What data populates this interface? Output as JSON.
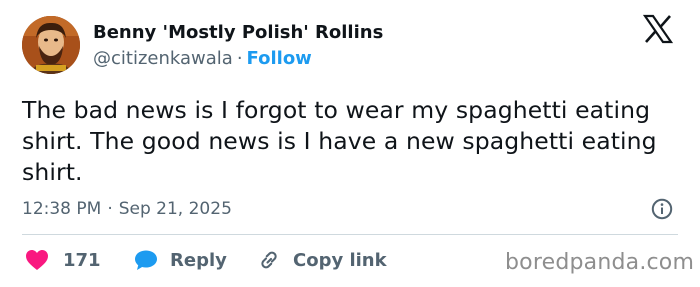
{
  "author": {
    "display_name": "Benny 'Mostly Polish' Rollins",
    "handle": "@citizenkawala",
    "separator": "·",
    "follow_label": "Follow"
  },
  "tweet": {
    "text": "The bad news is I forgot to wear my spaghetti eating shirt. The good news is I have a new spaghetti eating shirt.",
    "time": "12:38 PM",
    "date_separator": "·",
    "date": "Sep 21, 2025"
  },
  "actions": {
    "like_count": "171",
    "reply_label": "Reply",
    "copy_link_label": "Copy link"
  },
  "watermark": "boredpanda.com",
  "colors": {
    "like": "#f91880",
    "reply": "#1d9bf0",
    "follow": "#1d9bf0",
    "text_primary": "#0f1419",
    "text_secondary": "#536471"
  },
  "icons": {
    "brand": "x-logo-icon",
    "info": "info-icon",
    "like": "heart-icon",
    "reply": "speech-bubble-icon",
    "copy": "link-icon"
  }
}
